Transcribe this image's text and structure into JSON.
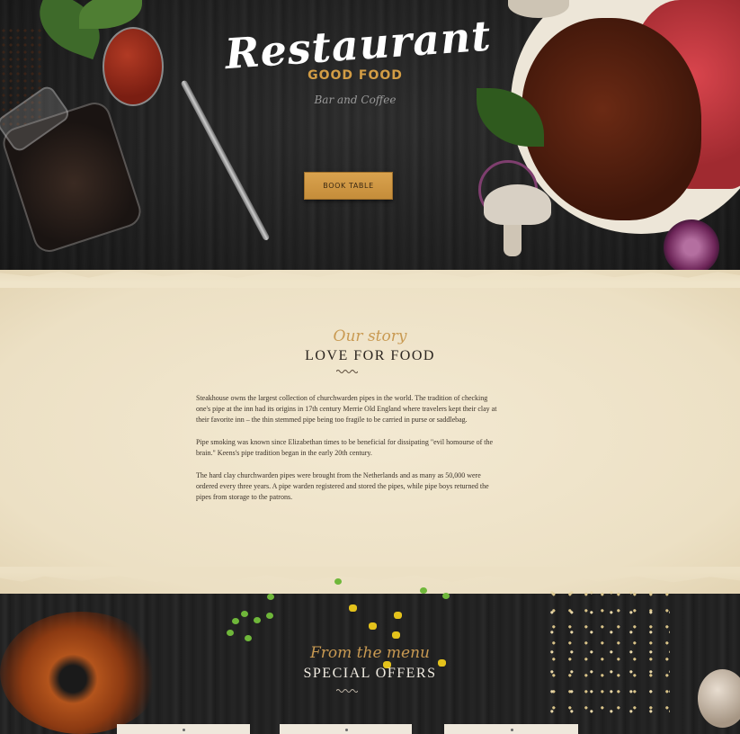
{
  "hero": {
    "logo_script": "Restaurant",
    "logo_sub": "GOOD FOOD",
    "logo_tag": "Bar and Coffee",
    "book_button": "BOOK TABLE"
  },
  "story": {
    "script_title": "Our story",
    "title": "LOVE FOR FOOD",
    "paragraphs": [
      "Steakhouse owns the largest collection of churchwarden pipes in the world. The tradition of checking one's pipe at the inn had its origins in 17th century Merrie Old England where travelers kept their clay at their favorite inn – the thin stemmed pipe being too fragile to be carried in purse or saddlebag.",
      "Pipe smoking was known since Elizabethan times to be beneficial for dissipating \"evil homourse of the brain.\" Keens's pipe tradition began in the early 20th century.",
      "The hard clay churchwarden pipes were brought from the Netherlands and as many as 50,000 were ordered every three years. A pipe warden registered and stored the pipes, while pipe boys returned the pipes from storage to the patrons."
    ]
  },
  "menu": {
    "script_title": "From the menu",
    "title": "SPECIAL OFFERS"
  },
  "colors": {
    "accent_gold": "#d39d45",
    "dark_wood": "#222222",
    "paper": "#efe4c9"
  }
}
